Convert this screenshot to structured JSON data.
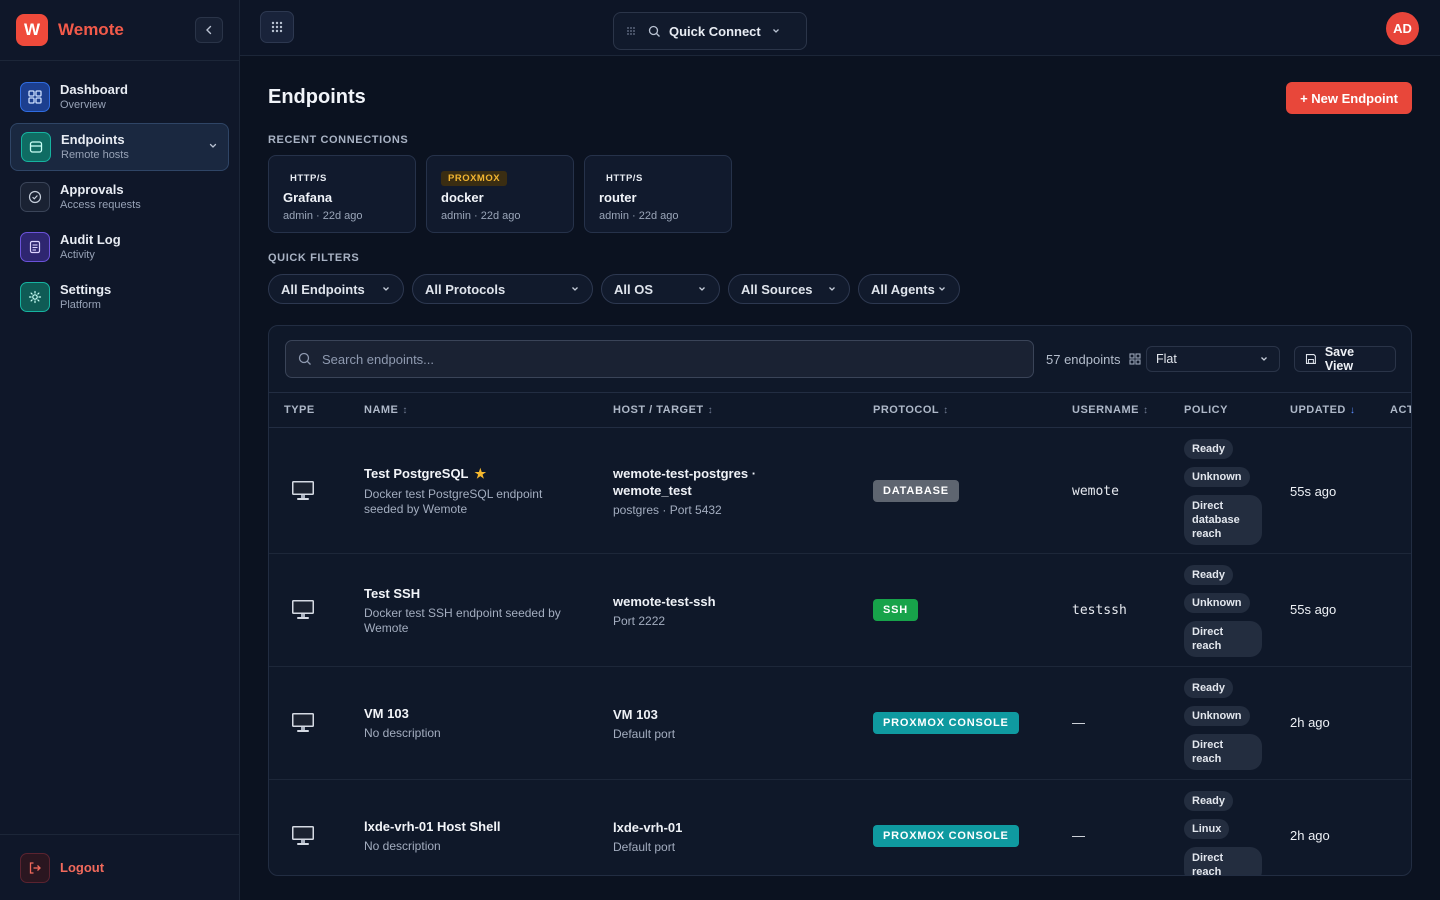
{
  "brand": {
    "letter": "W",
    "name": "Wemote"
  },
  "sidebar": {
    "items": [
      {
        "label": "Dashboard",
        "sub": "Overview",
        "icon": "dashboard-icon",
        "color": "#2f6ce0"
      },
      {
        "label": "Endpoints",
        "sub": "Remote hosts",
        "icon": "server-icon",
        "color": "#16b3a0"
      },
      {
        "label": "Approvals",
        "sub": "Access requests",
        "icon": "check-circle-icon",
        "color": "#6b7690"
      },
      {
        "label": "Audit Log",
        "sub": "Activity",
        "icon": "document-icon",
        "color": "#6a52d9"
      },
      {
        "label": "Settings",
        "sub": "Platform",
        "icon": "gear-icon",
        "color": "#16b3a0"
      }
    ],
    "logout": "Logout"
  },
  "topbar": {
    "quick_connect": "Quick Connect",
    "avatar": "AD"
  },
  "page": {
    "title": "Endpoints",
    "new_button": "+ New Endpoint",
    "recent_label": "RECENT CONNECTIONS",
    "filters_label": "QUICK FILTERS"
  },
  "recent": [
    {
      "protocol": "HTTP/S",
      "name": "Grafana",
      "meta": "admin · 22d ago"
    },
    {
      "protocol": "PROXMOX",
      "name": "docker",
      "meta": "admin · 22d ago"
    },
    {
      "protocol": "HTTP/S",
      "name": "router",
      "meta": "admin · 22d ago"
    }
  ],
  "filters": [
    "All Endpoints",
    "All Protocols",
    "All OS",
    "All Sources",
    "All Agents"
  ],
  "toolbar": {
    "search_placeholder": "Search endpoints...",
    "count": "57 endpoints",
    "view": "Flat",
    "save_view": "Save View"
  },
  "columns": [
    "TYPE",
    "NAME",
    "HOST / TARGET",
    "PROTOCOL",
    "USERNAME",
    "POLICY",
    "UPDATED",
    "ACT"
  ],
  "rows": [
    {
      "name": "Test PostgreSQL",
      "starred": true,
      "desc": [
        "Docker test PostgreSQL endpoint",
        "seeded by Wemote"
      ],
      "host": [
        "wemote-test-postgres ·",
        "wemote_test"
      ],
      "host_sub": "postgres · Port 5432",
      "protocol": "DATABASE",
      "protocol_color": "#5e6570",
      "username": "wemote",
      "policy": [
        "Ready",
        "Unknown"
      ],
      "policy_multi": [
        "Direct",
        "database",
        "reach"
      ],
      "updated": "55s ago"
    },
    {
      "name": "Test SSH",
      "starred": false,
      "desc": [
        "Docker test SSH endpoint seeded by",
        "Wemote"
      ],
      "host": [
        "wemote-test-ssh"
      ],
      "host_sub": "Port 2222",
      "protocol": "SSH",
      "protocol_color": "#17a34a",
      "username": "testssh",
      "policy": [
        "Ready",
        "Unknown"
      ],
      "policy_multi": [
        "Direct",
        "reach"
      ],
      "updated": "55s ago"
    },
    {
      "name": "VM 103",
      "starred": false,
      "desc": [
        "No description"
      ],
      "host": [
        "VM 103"
      ],
      "host_sub": "Default port",
      "protocol": "PROXMOX CONSOLE",
      "protocol_color": "#0f9aa0",
      "username": "—",
      "policy": [
        "Ready",
        "Unknown"
      ],
      "policy_multi": [
        "Direct",
        "reach"
      ],
      "updated": "2h ago"
    },
    {
      "name": "lxde-vrh-01 Host Shell",
      "starred": false,
      "desc": [
        "No description"
      ],
      "host": [
        "lxde-vrh-01"
      ],
      "host_sub": "Default port",
      "protocol": "PROXMOX CONSOLE",
      "protocol_color": "#0f9aa0",
      "username": "—",
      "policy": [
        "Ready",
        "Linux"
      ],
      "policy_multi": [
        "Direct",
        "reach"
      ],
      "updated": "2h ago"
    }
  ]
}
